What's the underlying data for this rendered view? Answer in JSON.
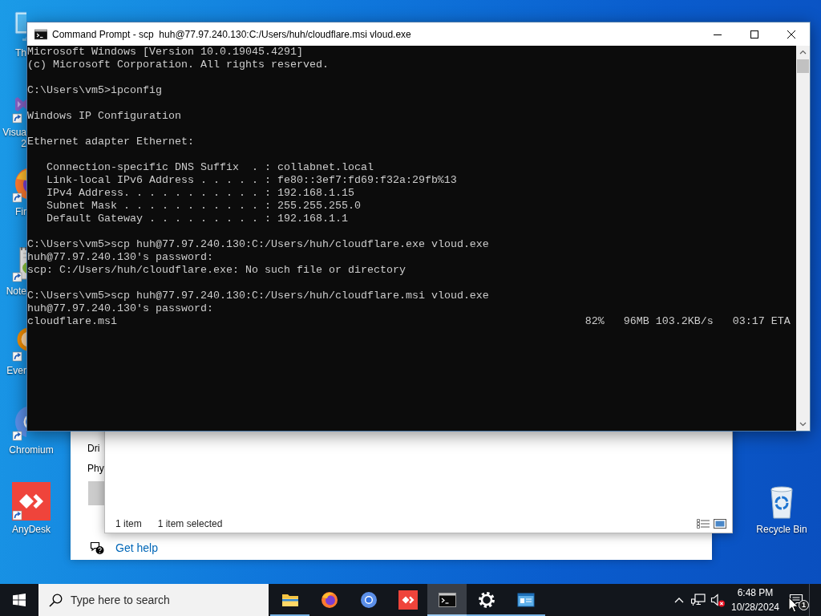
{
  "desktop": {
    "icons": [
      {
        "kind": "this-pc",
        "label": [
          "Th"
        ],
        "shortcut": false
      },
      {
        "kind": "visual-studio",
        "label": [
          "Visua",
          "2"
        ],
        "shortcut": true
      },
      {
        "kind": "firefox",
        "label": [
          "Fir"
        ],
        "shortcut": true
      },
      {
        "kind": "notepad",
        "label": [
          "Note"
        ],
        "shortcut": true
      },
      {
        "kind": "everything",
        "label": [
          "Ever"
        ],
        "shortcut": true
      },
      {
        "kind": "chromium",
        "label": [
          "Chromium"
        ],
        "shortcut": true
      },
      {
        "kind": "anydesk",
        "label": [
          "AnyDesk"
        ],
        "shortcut": true
      }
    ],
    "recycle_bin": {
      "label": "Recycle Bin"
    }
  },
  "settings_window": {
    "items": [
      "Dri",
      "Phy"
    ],
    "help_link": "Get help"
  },
  "explorer_window": {
    "status_bar": {
      "item_count": "1 item",
      "selection": "1 item selected"
    },
    "view_buttons": [
      {
        "kind": "details"
      },
      {
        "kind": "large-icons"
      }
    ]
  },
  "terminal": {
    "title": "Command Prompt - scp  huh@77.97.240.130:C:/Users/huh/cloudflare.msi vloud.exe",
    "blocks": [
      {
        "kind": "text",
        "lines": [
          "Microsoft Windows [Version 10.0.19045.4291]",
          "(c) Microsoft Corporation. All rights reserved."
        ]
      },
      {
        "kind": "text",
        "lines": [
          "C:\\Users\\vm5>ipconfig"
        ]
      },
      {
        "kind": "heading",
        "lines": [
          "Windows IP Configuration"
        ]
      },
      {
        "kind": "text",
        "lines": [
          "Ethernet adapter Ethernet:"
        ]
      },
      {
        "kind": "indented",
        "lines": [
          "Connection-specific DNS Suffix  . : collabnet.local",
          "Link-local IPv6 Address . . . . . : fe80::3ef7:fd69:f32a:29fb%13",
          "IPv4 Address. . . . . . . . . . . : 192.168.1.15",
          "Subnet Mask . . . . . . . . . . . : 255.255.255.0",
          "Default Gateway . . . . . . . . . : 192.168.1.1"
        ]
      },
      {
        "kind": "text",
        "lines": [
          "C:\\Users\\vm5>scp huh@77.97.240.130:C:/Users/huh/cloudflare.exe vloud.exe",
          "huh@77.97.240.130's password:",
          "scp: C:/Users/huh/cloudflare.exe: No such file or directory"
        ]
      },
      {
        "kind": "text",
        "lines": [
          "C:\\Users\\vm5>scp huh@77.97.240.130:C:/Users/huh/cloudflare.msi vloud.exe",
          "huh@77.97.240.130's password:"
        ]
      }
    ],
    "progress": {
      "file": "cloudflare.msi",
      "stats": "82%   96MB 103.2KB/s   03:17 ETA"
    }
  },
  "taskbar": {
    "search": {
      "placeholder": "Type here to search"
    },
    "apps": [
      {
        "kind": "file-explorer",
        "running": true,
        "selected": false
      },
      {
        "kind": "firefox",
        "running": false,
        "selected": false
      },
      {
        "kind": "chromium",
        "running": false,
        "selected": false
      },
      {
        "kind": "anydesk",
        "running": false,
        "selected": false
      },
      {
        "kind": "command-prompt",
        "running": true,
        "selected": true
      },
      {
        "kind": "settings",
        "running": true,
        "selected": false
      },
      {
        "kind": "system-window",
        "running": true,
        "selected": false
      }
    ],
    "tray": {
      "sound_muted": true,
      "time": "6:48 PM",
      "date": "10/28/2024",
      "notification_count": "1"
    }
  }
}
